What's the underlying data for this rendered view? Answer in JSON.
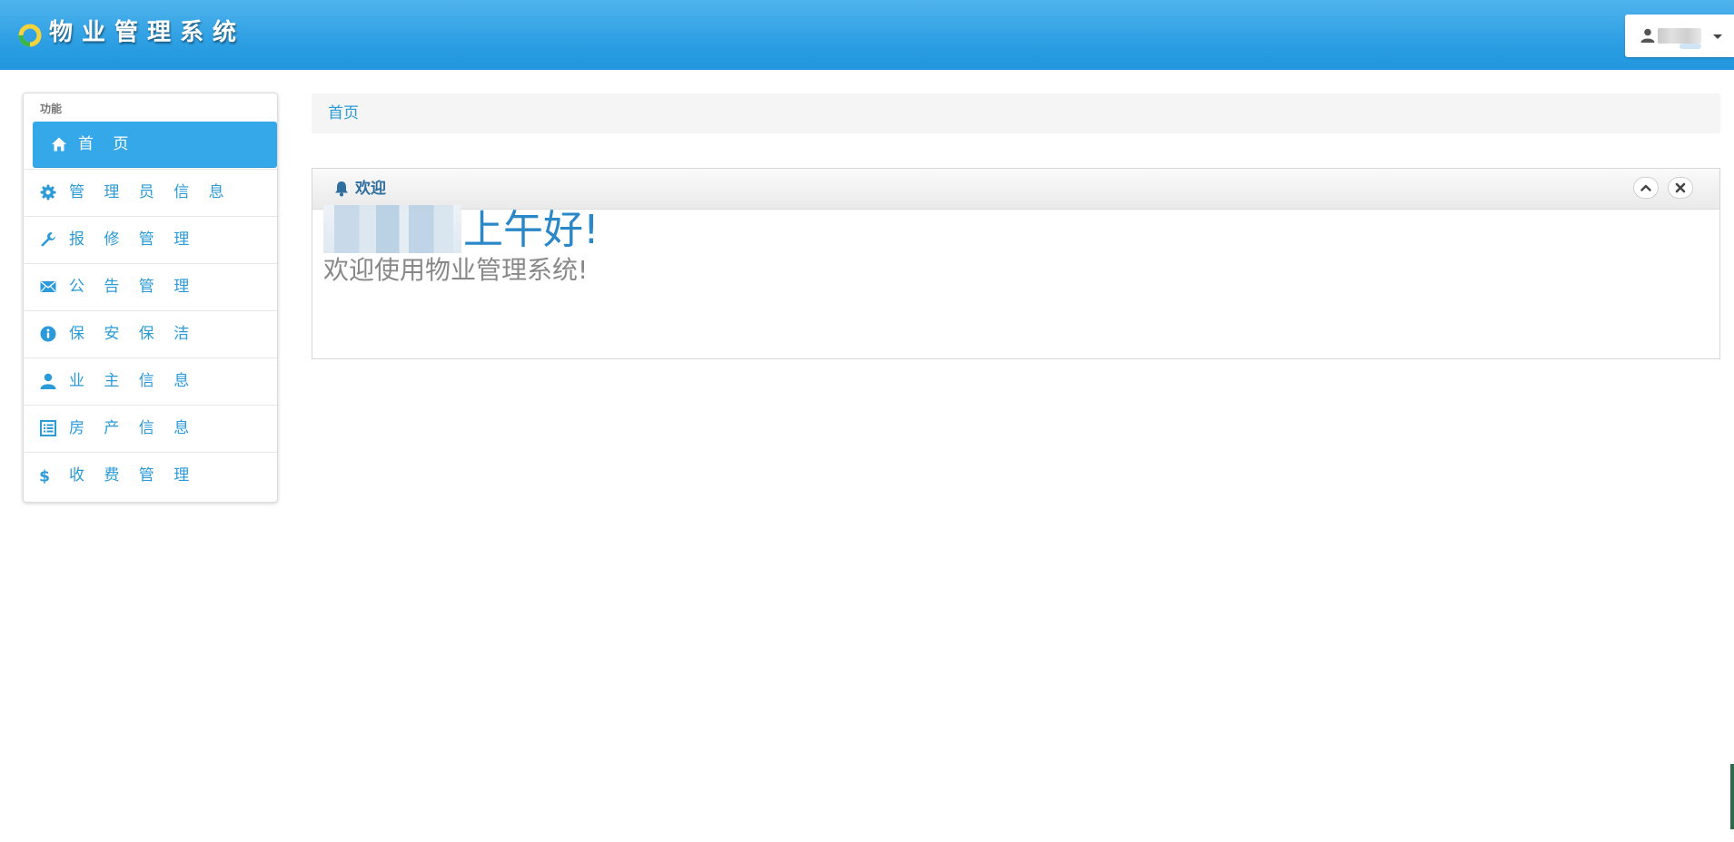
{
  "header": {
    "title": "物业管理系统",
    "logo_icon": "ring-logo-icon",
    "user_menu": {
      "name": "",
      "icon": "user-icon",
      "caret_icon": "caret-down-icon"
    }
  },
  "sidebar": {
    "heading": "功能",
    "items": [
      {
        "label": "首 页",
        "icon": "home-icon",
        "active": true
      },
      {
        "label": "管 理 员 信 息",
        "icon": "gear-icon"
      },
      {
        "label": "报 修 管 理",
        "icon": "wrench-icon"
      },
      {
        "label": "公 告 管 理",
        "icon": "envelope-icon"
      },
      {
        "label": "保 安 保 洁",
        "icon": "info-icon"
      },
      {
        "label": "业 主 信 息",
        "icon": "user-icon"
      },
      {
        "label": "房 产 信 息",
        "icon": "list-icon"
      },
      {
        "label": "收 费 管 理",
        "icon": "dollar-icon"
      }
    ]
  },
  "breadcrumb": {
    "current": "首页"
  },
  "welcome_box": {
    "title": "欢迎",
    "title_icon": "bell-icon",
    "collapse_icon": "chevron-up-icon",
    "close_icon": "close-icon",
    "greeting": "上午好!",
    "message": "欢迎使用物业管理系统!"
  },
  "colors": {
    "header": "#2d9fe3",
    "accent": "#34a8e8",
    "link": "#2a9ad8",
    "greeting": "#2a87c8"
  }
}
